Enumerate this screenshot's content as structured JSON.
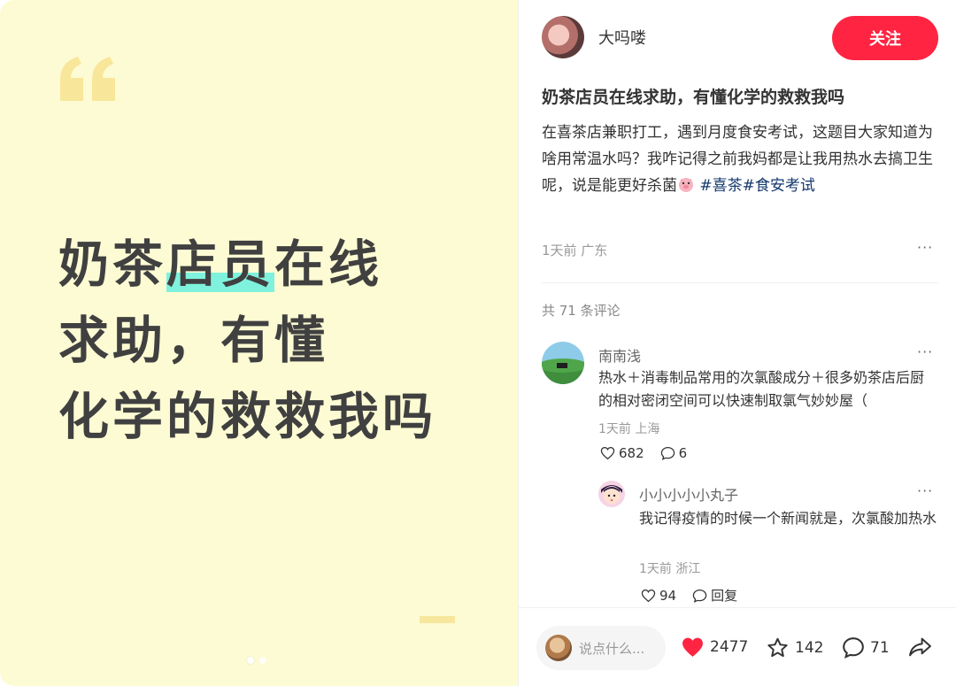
{
  "cover": {
    "lines": [
      "奶茶",
      "店员",
      "在线",
      "求助，有懂",
      "化学的救救我吗"
    ]
  },
  "author": {
    "name": "大吗喽",
    "follow_label": "关注"
  },
  "note": {
    "title": "奶茶店员在线求助，有懂化学的救救我吗",
    "desc": "在喜茶店兼职打工，遇到月度食安考试，这题目大家知道为啥用常温水吗？我咋记得之前我妈都是让我用热水去搞卫生呢，说是能更好杀菌",
    "tags": [
      "#喜茶",
      "#食安考试"
    ],
    "meta": "1天前 广东",
    "more": "···"
  },
  "comments": {
    "total_label": "共 71 条评论",
    "items": [
      {
        "name": "南南浅",
        "text": "热水＋消毒制品常用的次氯酸成分＋很多奶茶店后厨的相对密闭空间可以快速制取氯气妙妙屋（",
        "meta": "1天前 上海",
        "likes": "682",
        "replies": "6"
      },
      {
        "name": "小小小小小丸子",
        "text": "我记得疫情的时候一个新闻就是，次氯酸加热水",
        "meta": "1天前 浙江",
        "likes": "94",
        "reply_label": "回复"
      }
    ]
  },
  "bottom": {
    "placeholder": "说点什么...",
    "likes": "2477",
    "collects": "142",
    "comments": "71"
  },
  "colors": {
    "accent": "#ff2442",
    "tag": "#13386c",
    "cover_bg": "#fdfbd3",
    "highlight": "#7ff2dd"
  }
}
